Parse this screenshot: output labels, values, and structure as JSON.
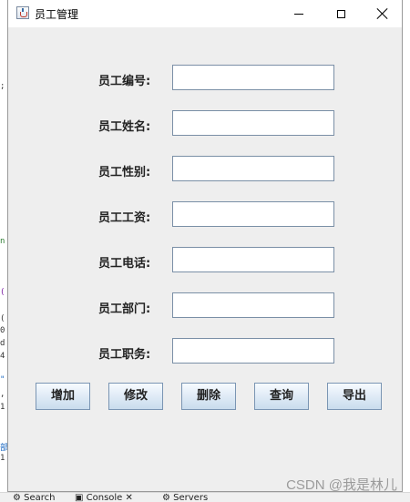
{
  "window": {
    "title": "员工管理"
  },
  "form": {
    "fields": [
      {
        "label": "员工编号:",
        "value": ""
      },
      {
        "label": "员工姓名:",
        "value": ""
      },
      {
        "label": "员工性别:",
        "value": ""
      },
      {
        "label": "员工工资:",
        "value": ""
      },
      {
        "label": "员工电话:",
        "value": ""
      },
      {
        "label": "员工部门:",
        "value": ""
      },
      {
        "label": "员工职务:",
        "value": ""
      }
    ]
  },
  "buttons": {
    "add": "增加",
    "modify": "修改",
    "delete": "删除",
    "query": "查询",
    "export": "导出"
  },
  "background_ide": {
    "tabs": [
      "Search",
      "Console",
      "Servers"
    ]
  },
  "watermark": "CSDN @我是林儿"
}
